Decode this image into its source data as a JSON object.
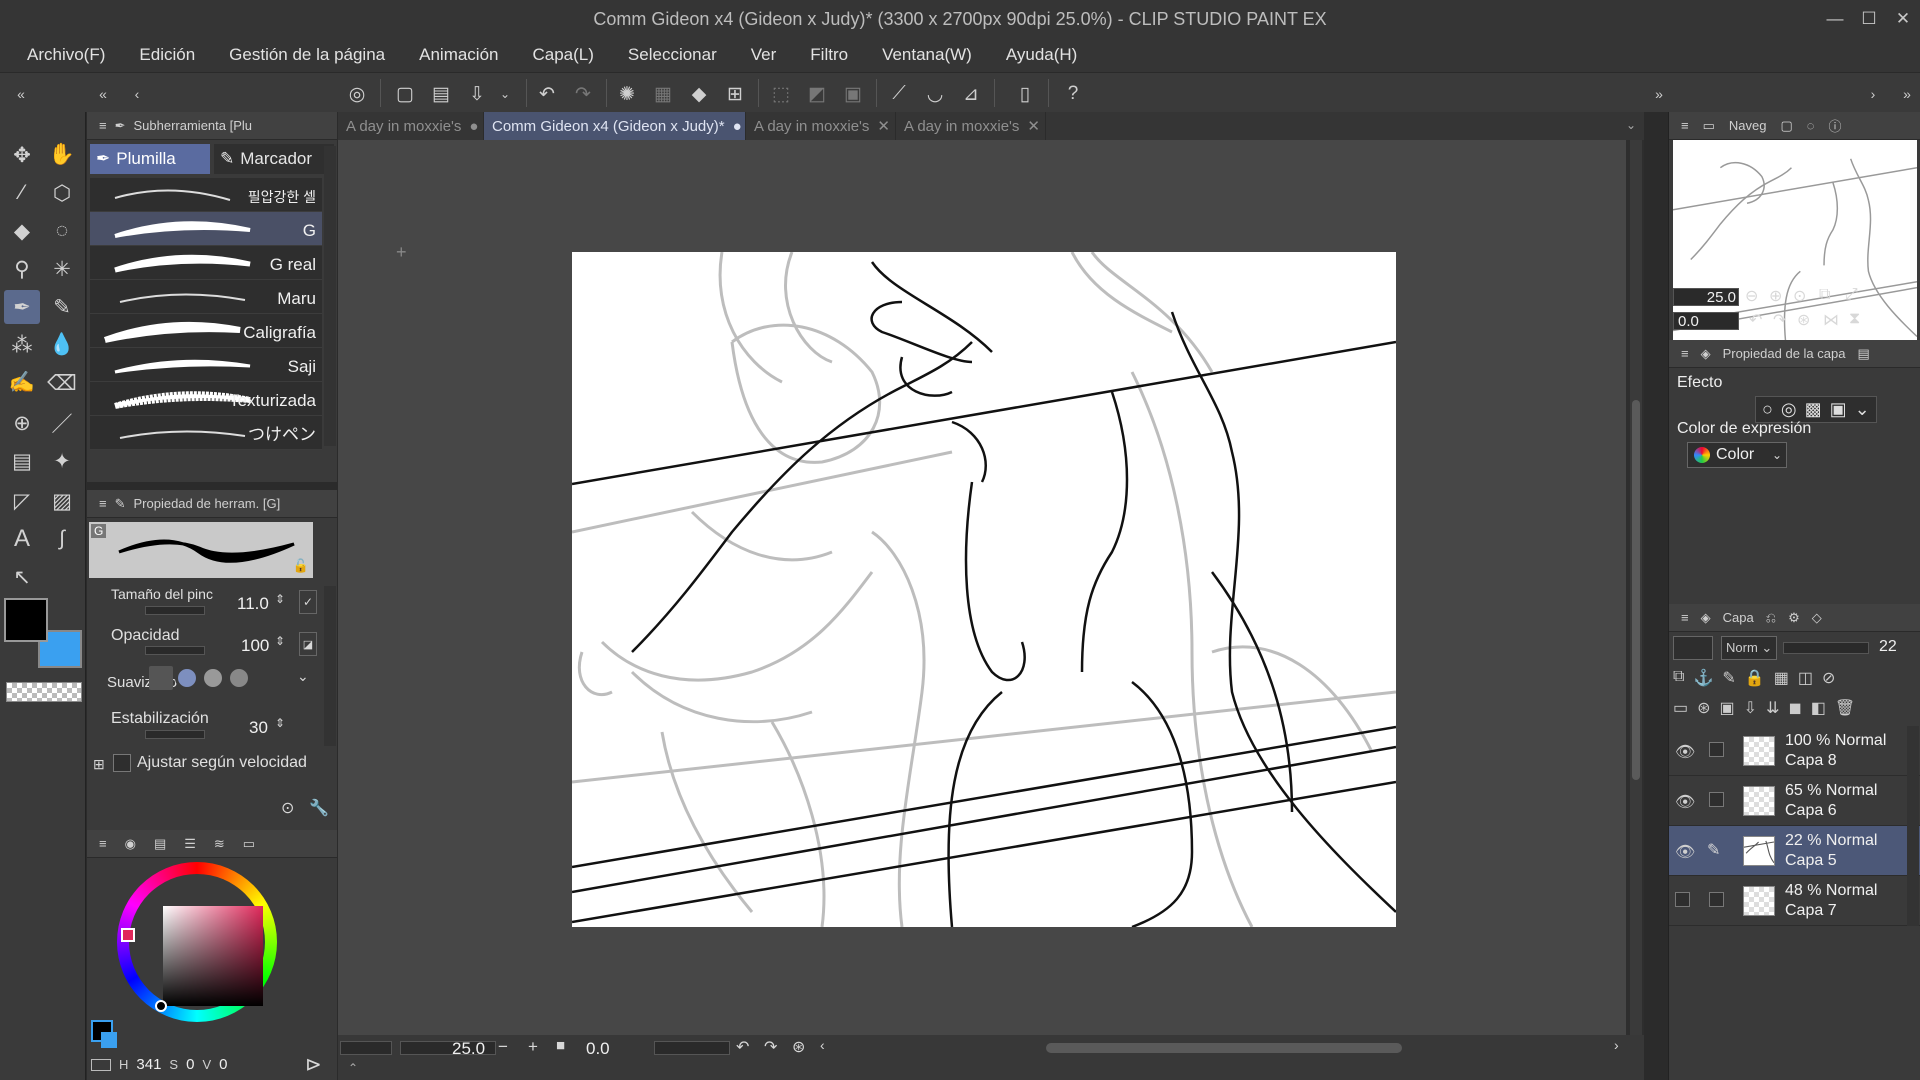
{
  "window": {
    "title": "Comm Gideon x4 (Gideon x Judy)* (3300 x 2700px 90dpi 25.0%)  - CLIP STUDIO PAINT EX"
  },
  "menu": [
    "Archivo(F)",
    "Edición",
    "Gestión de la página",
    "Animación",
    "Capa(L)",
    "Seleccionar",
    "Ver",
    "Filtro",
    "Ventana(W)",
    "Ayuda(H)"
  ],
  "subtool": {
    "header": "Subherramienta [Plu",
    "tabs": [
      "Plumilla",
      "Marcador"
    ],
    "brushes": [
      "필압강한 셀",
      "G",
      "G real",
      "Maru",
      "Caligrafía",
      "Saji",
      "Texturizada",
      "つけペン"
    ]
  },
  "toolprop": {
    "header": "Propiedad de herram. [G]",
    "preview_tag": "G",
    "size_label": "Tamaño del pinc",
    "size_value": "11.0",
    "opacity_label": "Opacidad",
    "opacity_value": "100",
    "smooth_label": "Suavizado",
    "stab_label": "Estabilización",
    "stab_value": "30",
    "speed_label": "Ajustar según velocidad"
  },
  "colorpanel": {
    "h": "341",
    "s": "0",
    "v": "0",
    "primary": "#000000",
    "secondary": "#3aa0f0"
  },
  "tabs": [
    {
      "label": "A day in moxxie's",
      "marker": "●"
    },
    {
      "label": "Comm Gideon x4 (Gideon x Judy)*",
      "marker": "●"
    },
    {
      "label": "A day in moxxie's",
      "marker": "✕"
    },
    {
      "label": "A day in moxxie's",
      "marker": "✕"
    }
  ],
  "status": {
    "zoom": "25.0",
    "angle": "0.0"
  },
  "navigator": {
    "header": "Naveg",
    "zoom": "25.0",
    "angle": "0.0"
  },
  "layerprop": {
    "header": "Propiedad de la capa",
    "effect": "Efecto",
    "expr": "Color de expresión",
    "color": "Color"
  },
  "layers": {
    "header": "Capa",
    "blend": "Norm",
    "opacity": "22",
    "items": [
      {
        "line1": "100 % Normal",
        "line2": "Capa 8"
      },
      {
        "line1": "65 % Normal",
        "line2": "Capa 6"
      },
      {
        "line1": "22 % Normal",
        "line2": "Capa 5"
      },
      {
        "line1": "48 % Normal",
        "line2": "Capa 7"
      }
    ]
  }
}
